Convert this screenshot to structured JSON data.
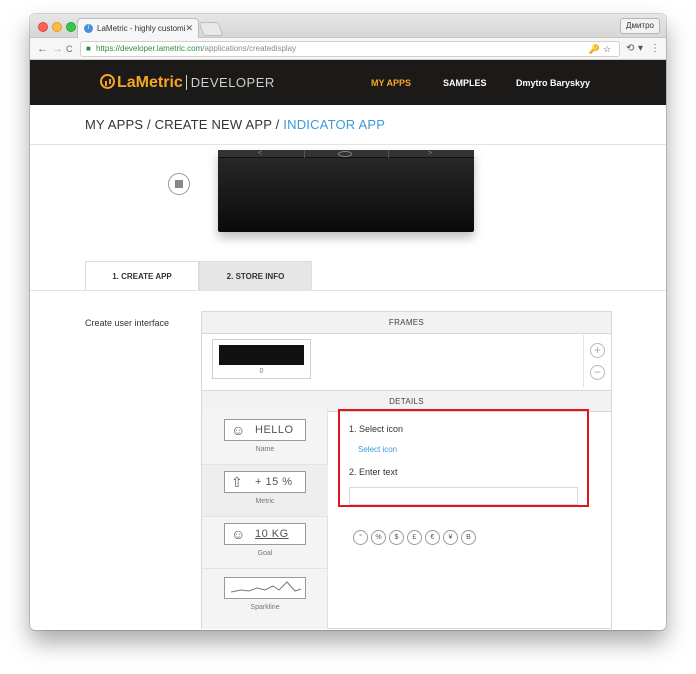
{
  "browser": {
    "tab_title": "LaMetric - highly customizable",
    "tab_close": "✕",
    "profile": "Дмитро",
    "url_main": "https://developer.lametric.com",
    "url_rest": "/applications/createdisplay",
    "nav_back": "←",
    "nav_forward": "→",
    "nav_reload": "C",
    "omni_icons": "🔑☆"
  },
  "header": {
    "logo_text": "LaMetric",
    "logo_sub": "DEVELOPER",
    "nav": [
      "MY APPS",
      "SAMPLES",
      "Dmytro Baryskyy"
    ],
    "accent": "#f5a623"
  },
  "breadcrumb": {
    "part1": "MY APPS / CREATE NEW APP / ",
    "current": "INDICATOR APP"
  },
  "device": {
    "left_btn": "<",
    "right_btn": ">"
  },
  "tabs": [
    "1. CREATE APP",
    "2. STORE INFO"
  ],
  "section": {
    "label": "Create user interface",
    "frames_header": "FRAMES",
    "frame_number": "0",
    "add_btn": "+",
    "remove_btn": "−",
    "details_header": "DETAILS"
  },
  "frame_types": [
    {
      "name": "Name",
      "icon": "☺",
      "text": "HELLO"
    },
    {
      "name": "Metric",
      "icon": "⇧",
      "text": "+ 15 %"
    },
    {
      "name": "Goal",
      "icon": "☺",
      "text": "10 KG"
    },
    {
      "name": "Sparkline",
      "icon": "",
      "text": ""
    }
  ],
  "details": {
    "select_icon_label": "1. Select icon",
    "select_icon_link": "Select icon",
    "enter_text_label": "2. Enter text",
    "text_value": ""
  },
  "symbols": [
    "°",
    "%",
    "$",
    "£",
    "€",
    "¥",
    "B"
  ]
}
